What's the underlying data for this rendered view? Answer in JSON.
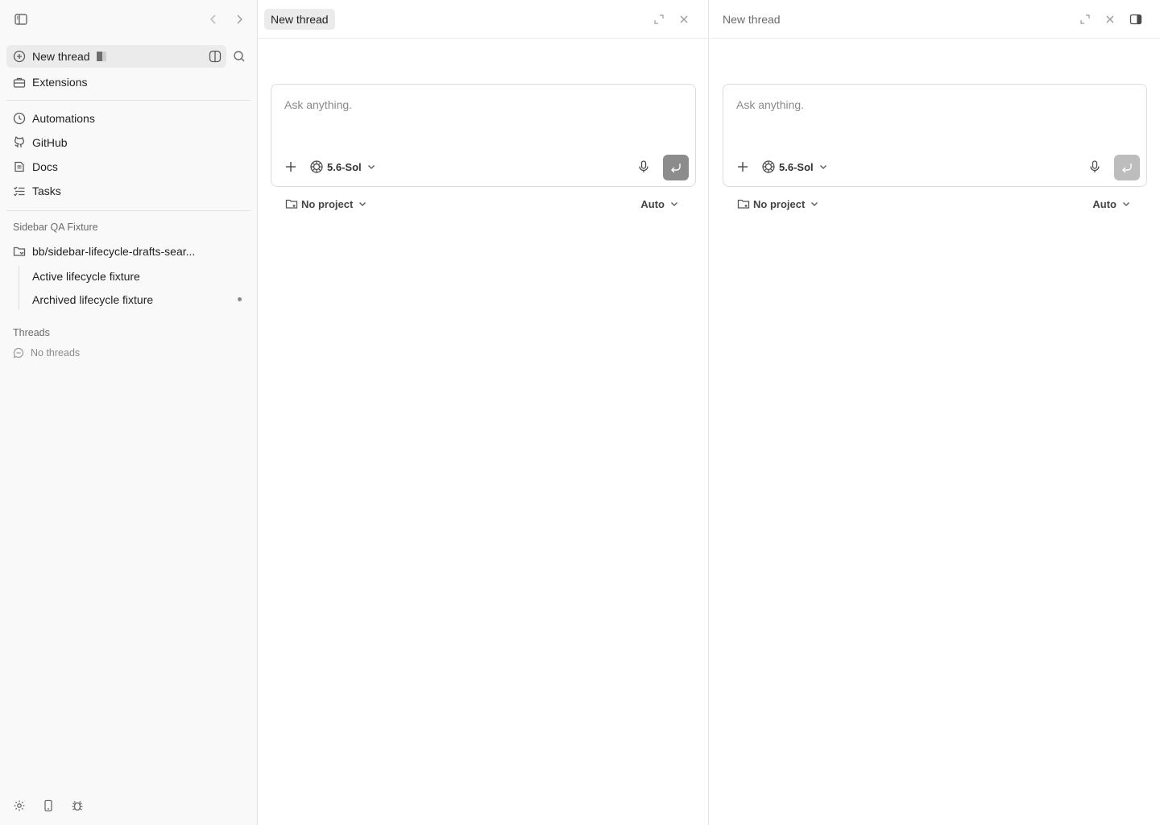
{
  "sidebar": {
    "new_thread_label": "New thread",
    "nav_primary": [
      {
        "label": "Extensions",
        "icon": "toolbox-icon"
      }
    ],
    "nav_secondary": [
      {
        "label": "Automations",
        "icon": "clock-icon"
      },
      {
        "label": "GitHub",
        "icon": "github-icon"
      },
      {
        "label": "Docs",
        "icon": "document-icon"
      },
      {
        "label": "Tasks",
        "icon": "checklist-icon"
      }
    ],
    "project_section_label": "Sidebar QA Fixture",
    "project_branch": "bb/sidebar-lifecycle-drafts-sear...",
    "project_threads": [
      {
        "label": "Active lifecycle fixture"
      },
      {
        "label": "Archived lifecycle fixture"
      }
    ],
    "threads_section_label": "Threads",
    "no_threads_label": "No threads"
  },
  "panes": [
    {
      "tab_label": "New thread",
      "placeholder": "Ask anything.",
      "model_label": "5.6-Sol",
      "project_label": "No project",
      "mode_label": "Auto"
    },
    {
      "tab_label": "New thread",
      "placeholder": "Ask anything.",
      "model_label": "5.6-Sol",
      "project_label": "No project",
      "mode_label": "Auto"
    }
  ],
  "colors": {
    "sidebar_bg": "#f9f9f9",
    "active_row_bg": "#ebebeb",
    "send_button_active": "#8c8c8c",
    "send_button_disabled": "#bdbdbd"
  }
}
